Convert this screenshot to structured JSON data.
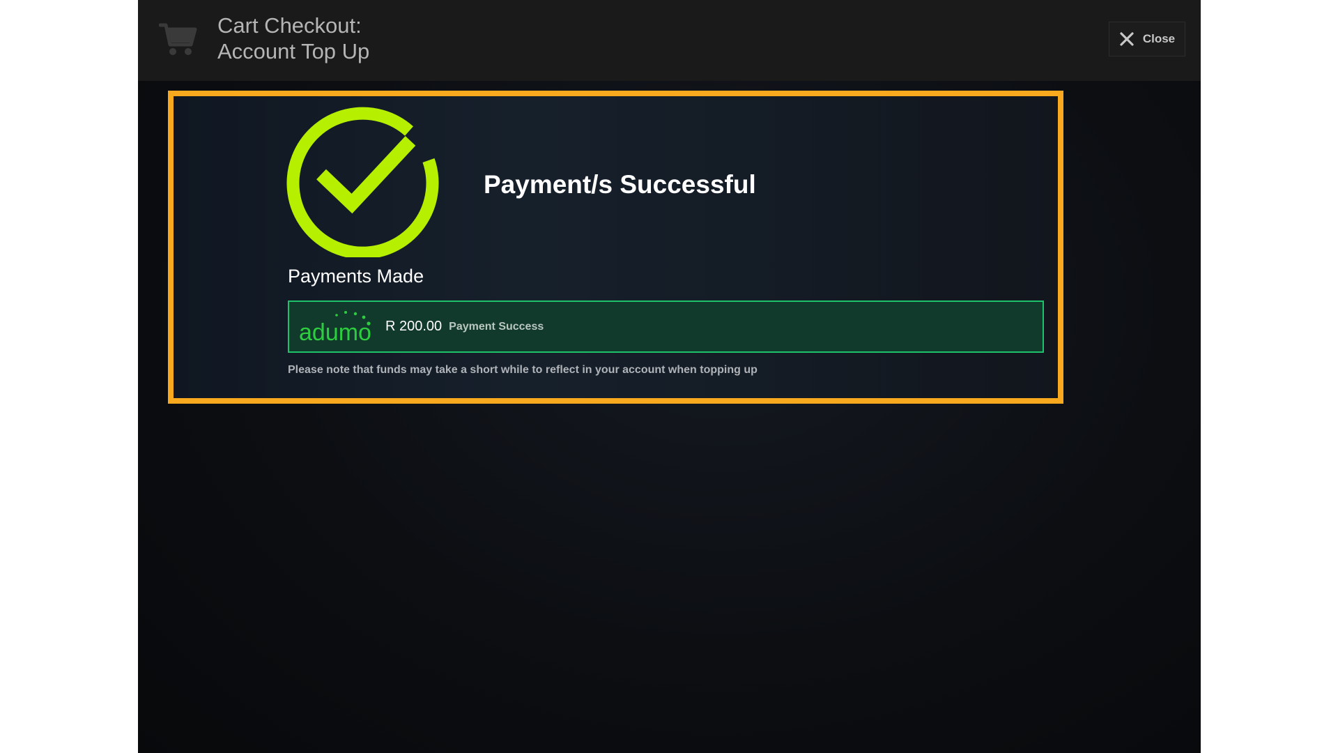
{
  "header": {
    "title_line1": "Cart Checkout:",
    "title_line2": "Account Top Up",
    "close_label": "Close",
    "cart_icon": "cart-icon",
    "close_icon": "close-icon"
  },
  "result": {
    "title": "Payment/s Successful",
    "icon": "check-circle-icon",
    "icon_color": "#b6f000"
  },
  "payments": {
    "heading": "Payments Made",
    "items": [
      {
        "provider_logo_text": "adumo",
        "amount": "R 200.00",
        "status": "Payment Success"
      }
    ]
  },
  "note": "Please note that funds may take a short while to reflect in your account when topping up",
  "colors": {
    "highlight_border": "#f8a91e",
    "payment_row_border": "#1ec26a",
    "payment_row_bg": "#123a2c",
    "brand_green": "#2ecc40"
  }
}
